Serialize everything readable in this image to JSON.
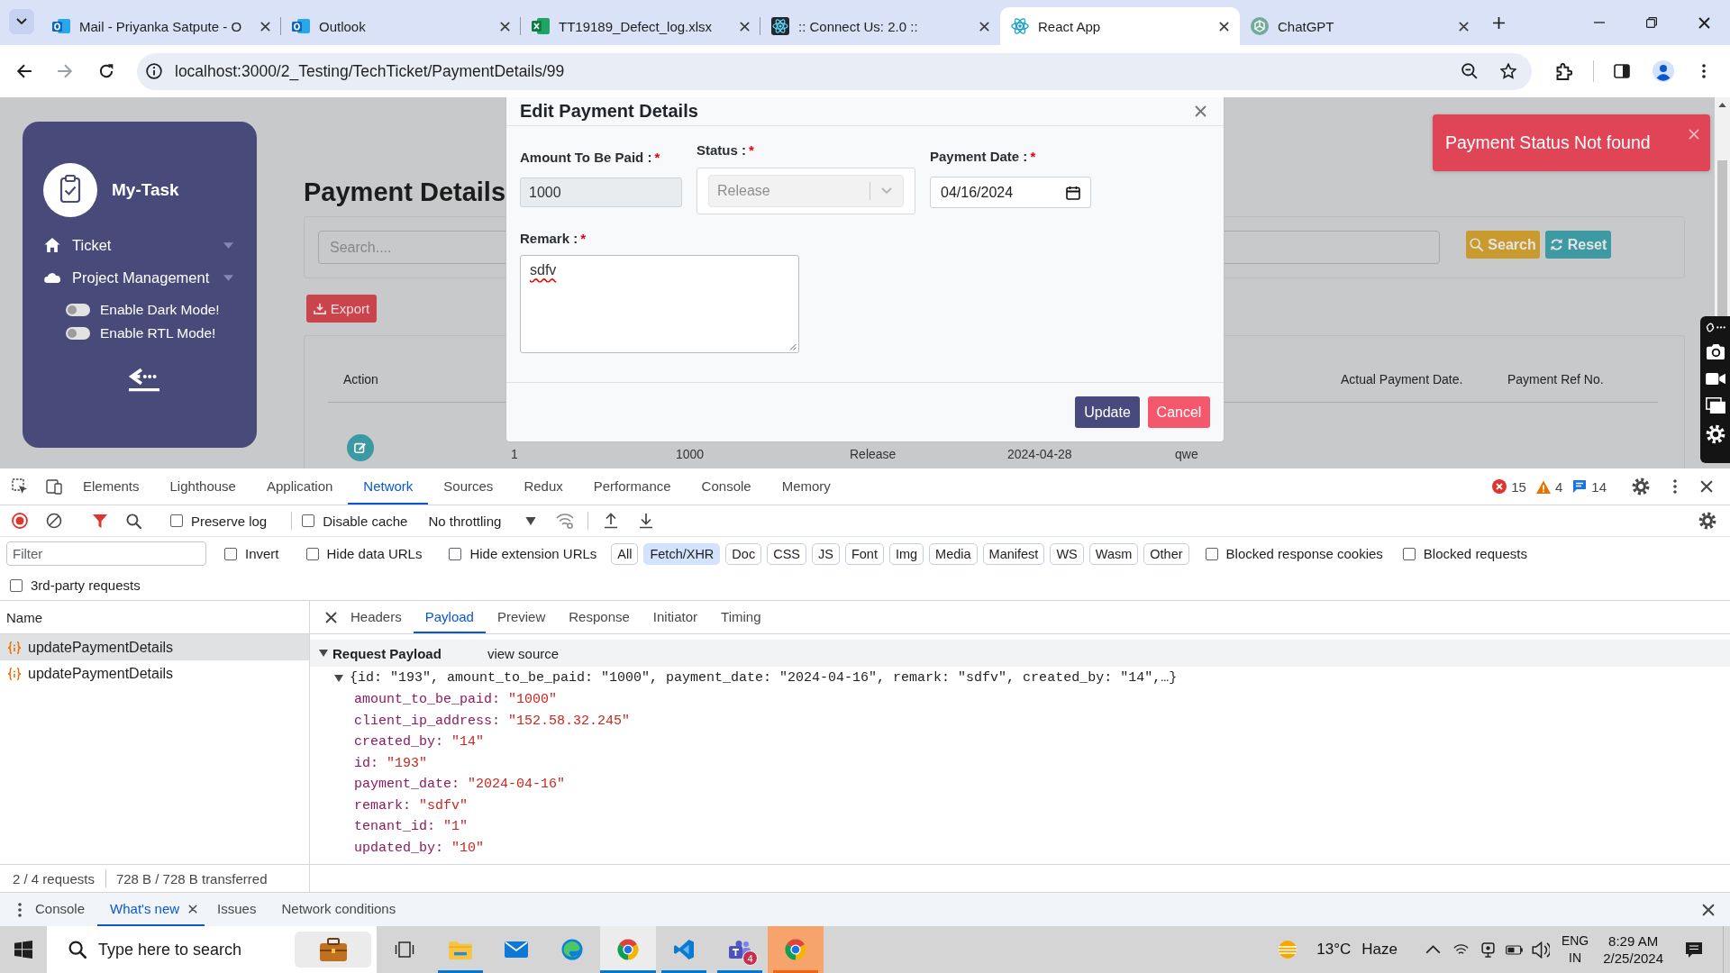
{
  "browser": {
    "tabs": [
      {
        "title": "Mail - Priyanka Satpute - O",
        "kind": "mail",
        "selected": false
      },
      {
        "title": "Outlook",
        "kind": "mail",
        "selected": false
      },
      {
        "title": "TT19189_Defect_log.xlsx",
        "kind": "sheet",
        "selected": false
      },
      {
        "title": ":: Connect Us: 2.0 ::",
        "kind": "atom-dark",
        "selected": false
      },
      {
        "title": "React App",
        "kind": "atom",
        "selected": true
      },
      {
        "title": "ChatGPT",
        "kind": "knot",
        "selected": false
      }
    ],
    "url": "localhost:3000/2_Testing/TechTicket/PaymentDetails/99"
  },
  "page": {
    "sidebar": {
      "brand": "My-Task",
      "items": [
        {
          "label": "Ticket",
          "kind": "home"
        },
        {
          "label": "Project Management",
          "kind": "cloud"
        }
      ],
      "toggles": [
        {
          "label": "Enable Dark Mode!",
          "on": false
        },
        {
          "label": "Enable RTL Mode!",
          "on": false
        }
      ]
    },
    "title": "Payment Details",
    "search": {
      "placeholder": "Search...."
    },
    "buttons": [
      {
        "label": "Search",
        "kind": "search"
      },
      {
        "label": "Reset",
        "kind": "reset"
      }
    ],
    "export": "Export",
    "table": {
      "columns": [
        "Action",
        "Actual Payment Date.",
        "Payment Ref No."
      ],
      "rows": [
        {
          "cells": [
            "1",
            "1000",
            "Release",
            "2024-04-28",
            "qwe"
          ]
        }
      ]
    }
  },
  "modal": {
    "title": "Edit Payment Details",
    "fields": [
      {
        "kind": "text",
        "label": "Amount To Be Paid :",
        "required_mark": "*",
        "value": "1000",
        "disabled": true
      },
      {
        "kind": "select",
        "label": "Status :",
        "required_mark": "*",
        "value": "Release",
        "disabled": true
      },
      {
        "kind": "date",
        "label": "Payment Date :",
        "required_mark": "*",
        "value": "04/16/2024",
        "disabled": false
      },
      {
        "kind": "textarea",
        "label": "Remark :",
        "required_mark": "*",
        "value": "sdfv",
        "disabled": false,
        "misspelled": true
      }
    ],
    "buttons": [
      {
        "label": "Update",
        "kind": "primary"
      },
      {
        "label": "Cancel",
        "kind": "danger"
      }
    ]
  },
  "toast": {
    "message": "Payment Status Not found"
  },
  "devtools": {
    "tabs": [
      {
        "label": "Elements",
        "selected": false
      },
      {
        "label": "Lighthouse",
        "selected": false
      },
      {
        "label": "Application",
        "selected": false
      },
      {
        "label": "Network",
        "selected": true
      },
      {
        "label": "Sources",
        "selected": false
      },
      {
        "label": "Redux",
        "selected": false
      },
      {
        "label": "Performance",
        "selected": false
      },
      {
        "label": "Console",
        "selected": false
      },
      {
        "label": "Memory",
        "selected": false
      }
    ],
    "counts": [
      {
        "kind": "error",
        "count": "15"
      },
      {
        "kind": "warning",
        "count": "4"
      },
      {
        "kind": "info",
        "count": "14"
      }
    ],
    "recording": true,
    "filter_active": true,
    "toolbar_options": [
      {
        "label": "Preserve log",
        "checked": false
      },
      {
        "label": "Disable cache",
        "checked": false
      }
    ],
    "throttling": "No throttling",
    "filter": {
      "placeholder": "Filter",
      "options": [
        {
          "label": "Invert",
          "checked": false
        },
        {
          "label": "Hide data URLs",
          "checked": false
        },
        {
          "label": "Hide extension URLs",
          "checked": false
        }
      ],
      "types": [
        {
          "label": "All",
          "selected": false
        },
        {
          "label": "Fetch/XHR",
          "selected": true
        },
        {
          "label": "Doc",
          "selected": false
        },
        {
          "label": "CSS",
          "selected": false
        },
        {
          "label": "JS",
          "selected": false
        },
        {
          "label": "Font",
          "selected": false
        },
        {
          "label": "Img",
          "selected": false
        },
        {
          "label": "Media",
          "selected": false
        },
        {
          "label": "Manifest",
          "selected": false
        },
        {
          "label": "WS",
          "selected": false
        },
        {
          "label": "Wasm",
          "selected": false
        },
        {
          "label": "Other",
          "selected": false
        }
      ],
      "more_options": [
        {
          "label": "Blocked response cookies",
          "checked": false
        },
        {
          "label": "Blocked requests",
          "checked": false
        }
      ],
      "third_party": {
        "label": "3rd-party requests",
        "checked": false
      }
    },
    "requests": {
      "column": "Name",
      "rows": [
        {
          "name": "updatePaymentDetails",
          "selected": true
        },
        {
          "name": "updatePaymentDetails",
          "selected": false
        }
      ],
      "status": [
        "2 / 4 requests",
        "728 B / 728 B transferred"
      ]
    },
    "detail": {
      "tabs": [
        {
          "label": "Headers",
          "selected": false
        },
        {
          "label": "Payload",
          "selected": true
        },
        {
          "label": "Preview",
          "selected": false
        },
        {
          "label": "Response",
          "selected": false
        },
        {
          "label": "Initiator",
          "selected": false
        },
        {
          "label": "Timing",
          "selected": false
        }
      ],
      "section": {
        "title": "Request Payload",
        "expanded": true,
        "link": "view source"
      },
      "object": {
        "summary": "{id: \"193\", amount_to_be_paid: \"1000\", payment_date: \"2024-04-16\", remark: \"sdfv\", created_by: \"14\",…}",
        "expanded": true,
        "properties": [
          {
            "key": "amount_to_be_paid:",
            "value": "\"1000\""
          },
          {
            "key": "client_ip_address:",
            "value": "\"152.58.32.245\""
          },
          {
            "key": "created_by:",
            "value": "\"14\""
          },
          {
            "key": "id:",
            "value": "\"193\""
          },
          {
            "key": "payment_date:",
            "value": "\"2024-04-16\""
          },
          {
            "key": "remark:",
            "value": "\"sdfv\""
          },
          {
            "key": "tenant_id:",
            "value": "\"1\""
          },
          {
            "key": "updated_by:",
            "value": "\"10\""
          }
        ]
      }
    },
    "drawer": {
      "tabs": [
        {
          "label": "Console",
          "selected": false,
          "closable": false
        },
        {
          "label": "What's new",
          "selected": true,
          "closable": true
        },
        {
          "label": "Issues",
          "selected": false,
          "closable": false
        },
        {
          "label": "Network conditions",
          "selected": false,
          "closable": false
        }
      ]
    }
  },
  "taskbar": {
    "search": {
      "placeholder": "Type here to search"
    },
    "apps": [
      {
        "kind": "folder",
        "running": true,
        "selected": false,
        "flashing": false
      },
      {
        "kind": "mail",
        "running": false,
        "selected": false,
        "flashing": false
      },
      {
        "kind": "swirl",
        "running": false,
        "selected": false,
        "flashing": false
      },
      {
        "kind": "chrome",
        "running": true,
        "selected": true,
        "flashing": false
      },
      {
        "kind": "code",
        "running": true,
        "selected": false,
        "flashing": false
      },
      {
        "kind": "teams",
        "running": true,
        "selected": false,
        "flashing": false,
        "badge": "4"
      },
      {
        "kind": "chrome",
        "running": true,
        "selected": false,
        "flashing": true
      }
    ],
    "weather": {
      "temperature": "13°C",
      "condition": "Haze"
    },
    "language": [
      "ENG",
      "IN"
    ],
    "time": "8:29 AM",
    "date": "2/25/2024"
  }
}
